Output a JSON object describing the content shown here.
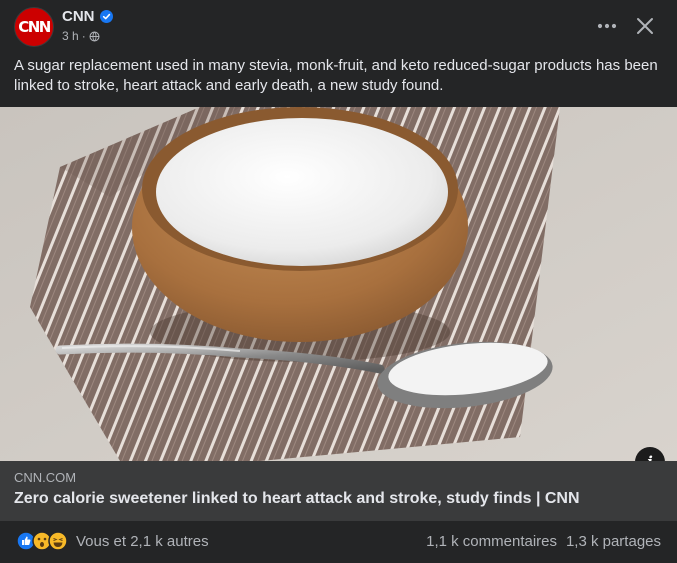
{
  "post": {
    "page_name": "CNN",
    "avatar_text": "CNN",
    "timestamp": "3 h",
    "separator": "·",
    "text": "A sugar replacement used in many stevia, monk-fruit, and keto reduced-sugar products has been linked to stroke, heart attack and early death, a new study found.",
    "verified_icon": "verified-badge-icon",
    "audience_icon": "globe-icon"
  },
  "header": {
    "more_icon": "more-horizontal-icon",
    "close_icon": "close-icon"
  },
  "link": {
    "domain": "CNN.COM",
    "title": "Zero calorie sweetener linked to heart attack and stroke, study finds | CNN",
    "image_subject": "wooden bowl of white sweetener with spoon on striped cloth",
    "info_label": "i"
  },
  "engagement": {
    "reactions_text": "Vous et 2,1 k autres",
    "reaction_types": [
      "like",
      "wow",
      "haha"
    ],
    "comments": "1,1 k commentaires",
    "shares": "1,3 k partages"
  },
  "colors": {
    "background": "#242526",
    "link_bar": "#3a3b3c",
    "text_primary": "#e4e6eb",
    "text_secondary": "#b0b3b8",
    "brand_red": "#cc0000",
    "verified_blue": "#1877f2"
  }
}
